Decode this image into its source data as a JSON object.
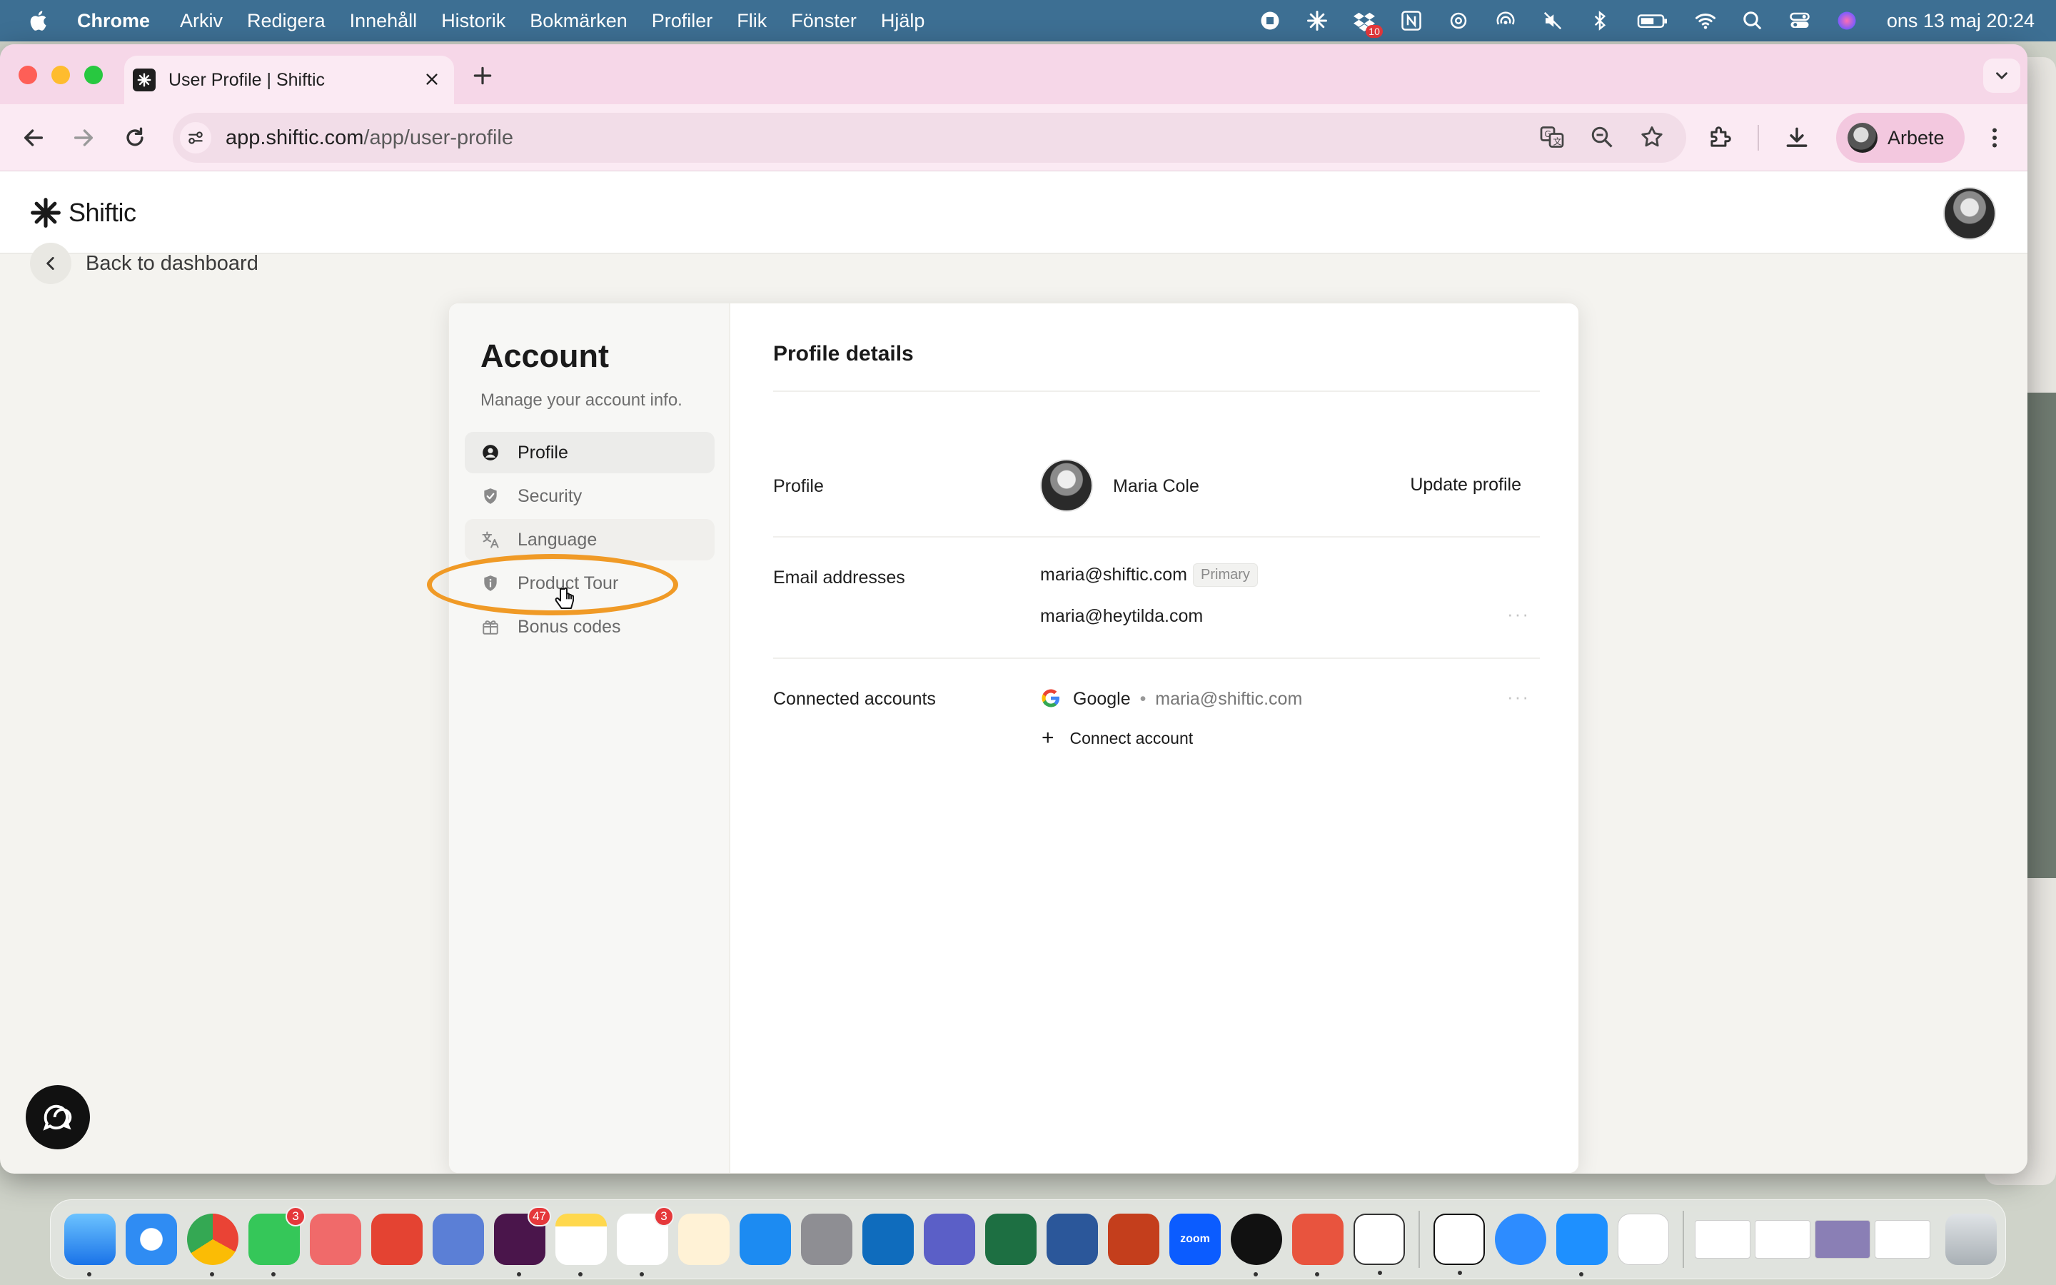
{
  "menubar": {
    "app_name": "Chrome",
    "items": [
      "Arkiv",
      "Redigera",
      "Innehåll",
      "Historik",
      "Bokmärken",
      "Profiler",
      "Flik",
      "Fönster",
      "Hjälp"
    ],
    "clock": "ons 13 maj 20:24",
    "dropbox_badge": "10"
  },
  "browser": {
    "tab_title": "User Profile | Shiftic",
    "url_host": "app.shiftic.com",
    "url_path": "/app/user-profile",
    "profile_name": "Arbete"
  },
  "app": {
    "logo_text": "Shiftic",
    "back_label": "Back to dashboard"
  },
  "account": {
    "title": "Account",
    "subtitle": "Manage your account info.",
    "nav": [
      {
        "label": "Profile",
        "icon": "user-circle-icon",
        "active": true
      },
      {
        "label": "Security",
        "icon": "shield-check-icon"
      },
      {
        "label": "Language",
        "icon": "translate-icon"
      },
      {
        "label": "Product Tour",
        "icon": "info-shield-icon"
      },
      {
        "label": "Bonus codes",
        "icon": "gift-icon"
      }
    ]
  },
  "profile_details": {
    "heading": "Profile details",
    "profile_label": "Profile",
    "name": "Maria Cole",
    "update_label": "Update profile",
    "email_label": "Email addresses",
    "emails": [
      "maria@shiftic.com",
      "maria@heytilda.com"
    ],
    "primary_badge": "Primary",
    "connected_label": "Connected accounts",
    "connected_provider": "Google",
    "connected_separator": "•",
    "connected_email": "maria@shiftic.com",
    "connect_label": "Connect account",
    "more_label": "···"
  },
  "dock": {
    "badges": {
      "messages": "3",
      "slack": "47",
      "reminders": "3"
    },
    "zoom_label": "zoom"
  },
  "colors": {
    "menubar": "#3d6f93",
    "tab_strip": "#f6d7e8",
    "highlight": "#f09a26"
  }
}
